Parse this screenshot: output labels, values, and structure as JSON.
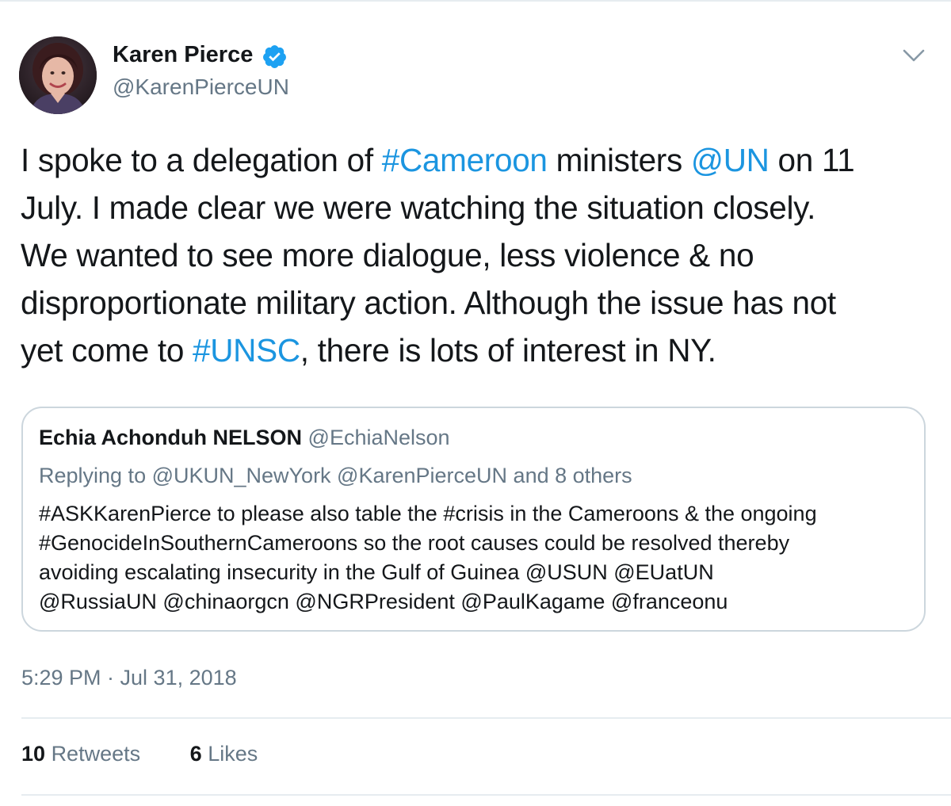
{
  "author": {
    "name": "Karen Pierce",
    "handle": "@KarenPierceUN",
    "verified": true
  },
  "tweet": {
    "lines": [
      [
        {
          "text": "I spoke to a delegation of ",
          "type": "text"
        },
        {
          "text": "#Cameroon",
          "type": "hashtag"
        },
        {
          "text": " ministers ",
          "type": "text"
        },
        {
          "text": "@UN",
          "type": "mention"
        },
        {
          "text": " on 11",
          "type": "text"
        }
      ],
      [
        {
          "text": "July. I made clear we were watching the situation closely.",
          "type": "text"
        }
      ],
      [
        {
          "text": "We wanted to see more dialogue, less violence & no",
          "type": "text"
        }
      ],
      [
        {
          "text": "disproportionate military action. Although the issue has not",
          "type": "text"
        }
      ],
      [
        {
          "text": "yet come to ",
          "type": "text"
        },
        {
          "text": "#UNSC",
          "type": "hashtag"
        },
        {
          "text": ", there is lots of interest in NY.",
          "type": "text"
        }
      ]
    ]
  },
  "quoted_tweet": {
    "name": "Echia Achonduh NELSON",
    "handle": "@EchiaNelson",
    "replying_to": "Replying to @UKUN_NewYork @KarenPierceUN and 8 others",
    "lines": [
      "#ASKKarenPierce to please also table the #crisis in the Cameroons & the ongoing",
      "#GenocideInSouthernCameroons so the root causes could be resolved thereby",
      "avoiding escalating insecurity in the Gulf of Guinea @USUN @EUatUN",
      "@RussiaUN @chinaorgcn @NGRPresident @PaulKagame @franceonu"
    ]
  },
  "timestamp": "5:29 PM · Jul 31, 2018",
  "stats": {
    "retweets_count": "10",
    "retweets_label": "Retweets",
    "likes_count": "6",
    "likes_label": "Likes"
  },
  "colors": {
    "link": "#1b95e0",
    "verified": "#1da1f2",
    "secondary_text": "#657786",
    "border": "#ccd6dd"
  },
  "icons": {
    "verified": "verified-badge-icon",
    "more": "chevron-down-icon"
  }
}
